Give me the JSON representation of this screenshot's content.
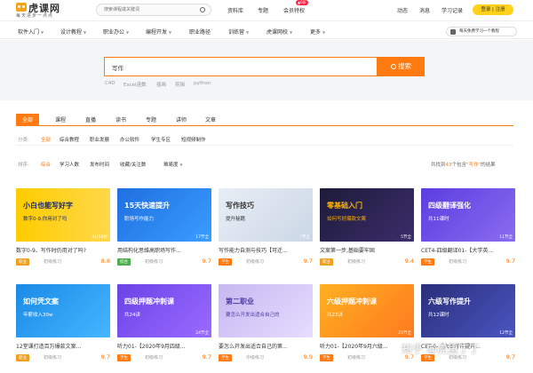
{
  "header": {
    "logo_text": "虎课网",
    "logo_slogan": "每天进步一点点",
    "search_placeholder": "搜索课程或关键词",
    "nav": [
      "资料库",
      "专题",
      "会员特权",
      "动态",
      "消息",
      "学习记录"
    ],
    "member_badge": "▲6折",
    "login_label": "登录 | 注册"
  },
  "categories": {
    "items": [
      "软件入门",
      "设计教程",
      "职业办公",
      "编程开发",
      "职业路径",
      "训练营",
      "虎课网校",
      "更多"
    ],
    "app_label": "每天免费学习一个教程"
  },
  "search": {
    "query": "写作",
    "button_label": "搜索",
    "hot": [
      "C4D",
      "Excel函数",
      "插画",
      "剪辑",
      "python"
    ]
  },
  "tabs": {
    "items": [
      "全部",
      "课程",
      "直播",
      "读书",
      "专题",
      "讲师",
      "文章"
    ],
    "active": 0
  },
  "filters": {
    "label": "分类:",
    "items": [
      "全部",
      "综合教程",
      "职业发展",
      "办公软件",
      "学生专区",
      "短视频制作"
    ]
  },
  "sort": {
    "label": "排序:",
    "items": [
      "综合",
      "学习人数",
      "发布时间",
      "收藏/关注数",
      "难易度"
    ],
    "summary_prefix": "共找到",
    "summary_count": "43",
    "summary_mid": "个包含",
    "summary_query": "\"写作\"",
    "summary_suffix": "的结果"
  },
  "cards": [
    {
      "title": "数字0-9、写作时仍用对了吗?",
      "tag": "职业",
      "level": "初级练习",
      "score": "8.8",
      "duration": "4分58秒",
      "thumb": [
        "小白也能写好字",
        "数字0-9,你用对了吗"
      ]
    },
    {
      "title": "用结构化思维高职场写作...",
      "tag": "综合",
      "level": "初级练习",
      "score": "9.7",
      "duration": "17节全",
      "thumb": [
        "15天快速提升",
        "职场写作能力"
      ]
    },
    {
      "title": "写作能力自测与技巧【可迁...",
      "tag": "学生",
      "level": "初级练习",
      "score": "9.7",
      "duration": "7节全",
      "thumb": [
        "写作技巧",
        "提升秘籍"
      ]
    },
    {
      "title": "文案第一步,基础要牢固",
      "tag": "职业",
      "level": "初级练习",
      "score": "9.4",
      "duration": "5节全",
      "thumb": [
        "零基础入门",
        "如何写好爆款文案"
      ]
    },
    {
      "title": "CET4-四级翻译01-【大学英...",
      "tag": "学生",
      "level": "初级练习",
      "score": "9.7",
      "duration": "11节全",
      "thumb": [
        "四级翻译强化",
        "共11课时"
      ]
    },
    {
      "title": "12堂课打造百万爆款文案...",
      "tag": "职业",
      "level": "初级练习",
      "score": "9.7",
      "duration": "",
      "thumb": [
        "如何凭文案",
        "年薪收入30w"
      ]
    },
    {
      "title": "听力01-【2020年9月四级...",
      "tag": "学生",
      "level": "初级练习",
      "score": "9.7",
      "duration": "24节全",
      "thumb": [
        "四级押题冲刺课",
        "共24讲"
      ]
    },
    {
      "title": "要怎么开发出适合自己的第...",
      "tag": "学生",
      "level": "中级练习",
      "score": "9.9",
      "duration": "",
      "thumb": [
        "第二职业",
        "要怎么开发出适合自己的"
      ]
    },
    {
      "title": "听力01-【2020年9月六级...",
      "tag": "学生",
      "level": "初级练习",
      "score": "9.7",
      "duration": "23节全",
      "thumb": [
        "六级押题冲刺课",
        "共23讲"
      ]
    },
    {
      "title": "CET-6-【六级写作提升...",
      "tag": "学生",
      "level": "初级练习",
      "score": "9.7",
      "duration": "12节全",
      "thumb": [
        "六级写作提升",
        "共12课时"
      ]
    }
  ],
  "watermark": "知乎 @虎里丁丁",
  "colors": {
    "accent": "#ff7a10",
    "tag_job": "#f0a020",
    "tag_student": "#ff7a10",
    "tag_general": "#4cae4c"
  }
}
